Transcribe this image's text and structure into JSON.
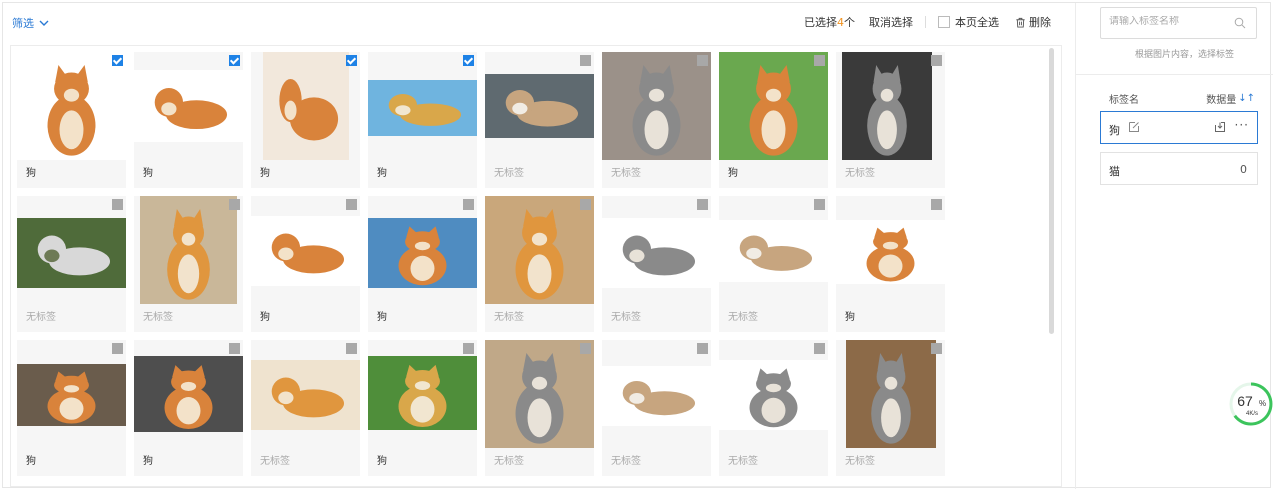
{
  "toolbar": {
    "filter_label": "筛选",
    "selected_prefix": "已选择",
    "selected_count": "4",
    "selected_suffix": "个",
    "cancel_label": "取消选择",
    "select_all_label": "本页全选",
    "delete_label": "删除"
  },
  "images": [
    {
      "label": "狗",
      "checked": true,
      "subject": "shiba-sitting"
    },
    {
      "label": "狗",
      "checked": true,
      "subject": "shiba-lying"
    },
    {
      "label": "狗",
      "checked": true,
      "subject": "shiba-with-toys"
    },
    {
      "label": "狗",
      "checked": true,
      "subject": "golden-puppy"
    },
    {
      "label": "无标签",
      "checked": false,
      "subject": "kitten-basket"
    },
    {
      "label": "无标签",
      "checked": false,
      "subject": "grey-cat-pavement"
    },
    {
      "label": "狗",
      "checked": false,
      "subject": "shiba-grass"
    },
    {
      "label": "无标签",
      "checked": false,
      "subject": "tabby-cat-sitting"
    },
    {
      "label": "无标签",
      "checked": false,
      "subject": "white-cat-lying"
    },
    {
      "label": "无标签",
      "checked": false,
      "subject": "cream-cat-sitting"
    },
    {
      "label": "狗",
      "checked": false,
      "subject": "shiba-lying-2"
    },
    {
      "label": "狗",
      "checked": false,
      "subject": "corgi-dock"
    },
    {
      "label": "无标签",
      "checked": false,
      "subject": "orange-cat-closeup"
    },
    {
      "label": "无标签",
      "checked": false,
      "subject": "grey-white-cat-lying"
    },
    {
      "label": "无标签",
      "checked": false,
      "subject": "kitten-rolling"
    },
    {
      "label": "狗",
      "checked": false,
      "subject": "shiba-standing"
    },
    {
      "label": "狗",
      "checked": false,
      "subject": "shiba-pair"
    },
    {
      "label": "狗",
      "checked": false,
      "subject": "shiba-portrait"
    },
    {
      "label": "无标签",
      "checked": false,
      "subject": "orange-cat-lying"
    },
    {
      "label": "狗",
      "checked": false,
      "subject": "golden-puppies-pair"
    },
    {
      "label": "无标签",
      "checked": false,
      "subject": "tabby-cat-flat"
    },
    {
      "label": "无标签",
      "checked": false,
      "subject": "kitten-peeking"
    },
    {
      "label": "无标签",
      "checked": false,
      "subject": "grey-white-kitten"
    },
    {
      "label": "无标签",
      "checked": false,
      "subject": "tabby-cat-stairs"
    }
  ],
  "panel": {
    "search_placeholder": "请输入标签名称",
    "hint": "根据图片内容，选择标签",
    "col_name": "标签名",
    "col_count": "数据量",
    "tags": [
      {
        "name": "狗",
        "count": "",
        "active": true
      },
      {
        "name": "猫",
        "count": "0",
        "active": false
      }
    ]
  },
  "speed_widget": {
    "percent": "67",
    "unit": "%",
    "rate": "4K/s"
  },
  "colors": {
    "accent": "#2b7ad4",
    "highlight": "#f19320",
    "checked": "#1e82e6"
  }
}
